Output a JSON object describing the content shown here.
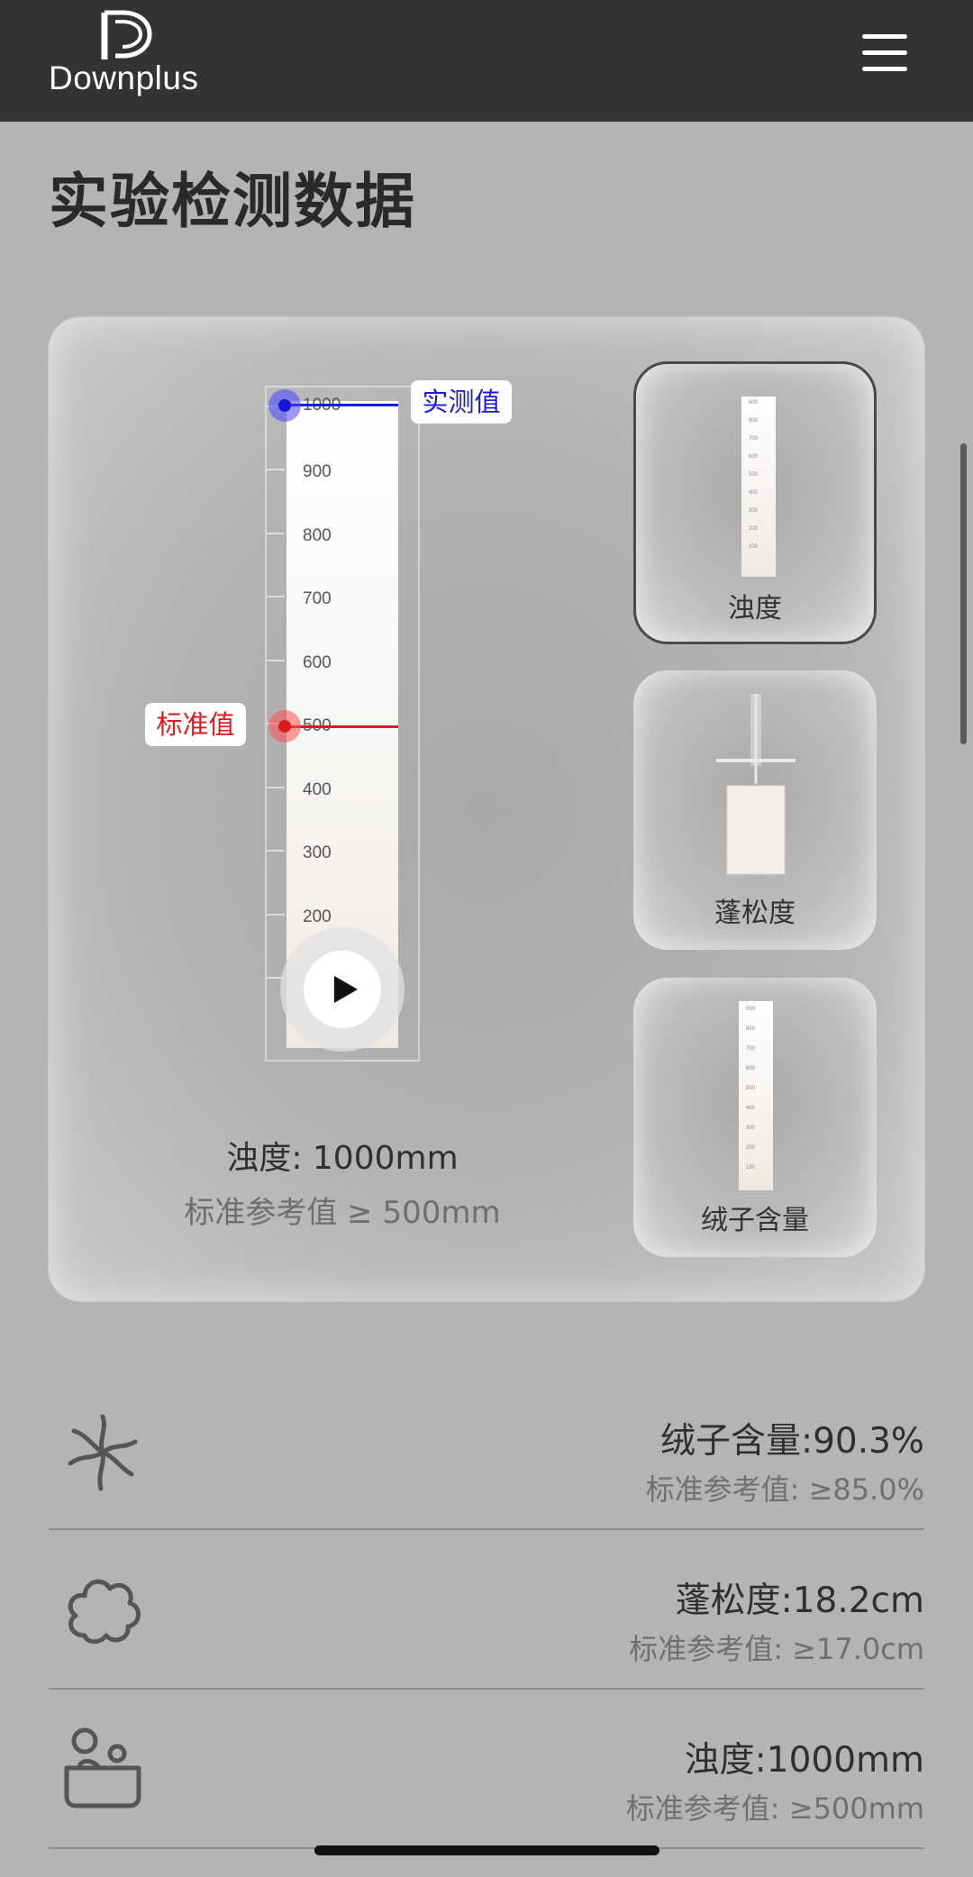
{
  "header": {
    "brand": "Downplus",
    "menu_icon": "hamburger-menu-icon"
  },
  "page": {
    "title": "实验检测数据"
  },
  "viewer": {
    "measured_tag": "实测值",
    "standard_tag": "标准值",
    "ruler_ticks": [
      "1000",
      "900",
      "800",
      "700",
      "600",
      "500",
      "400",
      "300",
      "200"
    ],
    "measured_value": 1000,
    "standard_value": 500,
    "reading": "浊度: 1000mm",
    "reference": "标准参考值 ≥ 500mm",
    "play_icon": "play-icon",
    "measured_color": "#1a1ad8",
    "standard_color": "#e01a1a"
  },
  "thumbnails": [
    {
      "label": "浊度",
      "selected": true
    },
    {
      "label": "蓬松度",
      "selected": false
    },
    {
      "label": "绒子含量",
      "selected": false
    }
  ],
  "stats": [
    {
      "icon": "down-cluster-icon",
      "value": "绒子含量:90.3%",
      "reference": "标准参考值: ≥85.0%"
    },
    {
      "icon": "cloud-icon",
      "value": "蓬松度:18.2cm",
      "reference": "标准参考值: ≥17.0cm"
    },
    {
      "icon": "person-bath-icon",
      "value": "浊度:1000mm",
      "reference": "标准参考值: ≥500mm"
    }
  ]
}
